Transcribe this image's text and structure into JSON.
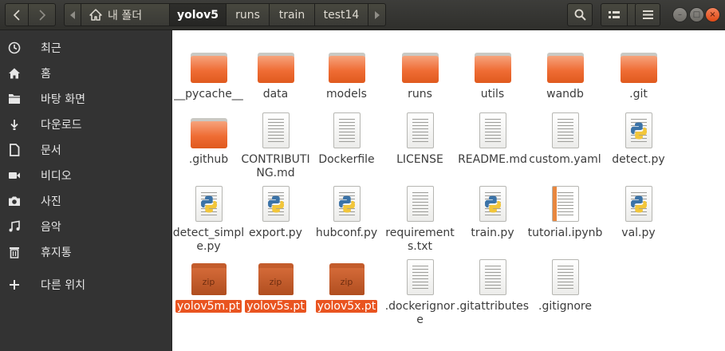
{
  "nav": {
    "back_icon": "chevron-left",
    "forward_icon": "chevron-right"
  },
  "breadcrumb": {
    "home_label": "내 폴더",
    "segments": [
      "yolov5",
      "runs",
      "train",
      "test14"
    ]
  },
  "toolbar": {
    "search_icon": "search",
    "view_icon": "grid-view",
    "menu_icon": "hamburger-menu"
  },
  "window_controls": {
    "minimize": "–",
    "maximize": "□",
    "close": "×"
  },
  "sidebar": {
    "items": [
      {
        "label": "최근",
        "icon": "clock"
      },
      {
        "label": "홈",
        "icon": "home"
      },
      {
        "label": "바탕 화면",
        "icon": "folder"
      },
      {
        "label": "다운로드",
        "icon": "download"
      },
      {
        "label": "문서",
        "icon": "document"
      },
      {
        "label": "비디오",
        "icon": "video"
      },
      {
        "label": "사진",
        "icon": "camera"
      },
      {
        "label": "음악",
        "icon": "music"
      },
      {
        "label": "휴지통",
        "icon": "trash"
      },
      {
        "label": "다른 위치",
        "icon": "plus"
      }
    ]
  },
  "files": [
    {
      "name": "__pycache__",
      "kind": "folder"
    },
    {
      "name": "data",
      "kind": "folder"
    },
    {
      "name": "models",
      "kind": "folder"
    },
    {
      "name": "runs",
      "kind": "folder"
    },
    {
      "name": "utils",
      "kind": "folder"
    },
    {
      "name": "wandb",
      "kind": "folder"
    },
    {
      "name": ".git",
      "kind": "folder"
    },
    {
      "name": ".github",
      "kind": "folder"
    },
    {
      "name": "CONTRIBUTING.md",
      "kind": "text"
    },
    {
      "name": "Dockerfile",
      "kind": "text"
    },
    {
      "name": "LICENSE",
      "kind": "text"
    },
    {
      "name": "README.md",
      "kind": "text"
    },
    {
      "name": "custom.yaml",
      "kind": "text"
    },
    {
      "name": "detect.py",
      "kind": "python"
    },
    {
      "name": "detect_simple.py",
      "kind": "python"
    },
    {
      "name": "export.py",
      "kind": "python"
    },
    {
      "name": "hubconf.py",
      "kind": "python"
    },
    {
      "name": "requirements.txt",
      "kind": "text"
    },
    {
      "name": "train.py",
      "kind": "python"
    },
    {
      "name": "tutorial.ipynb",
      "kind": "notebook"
    },
    {
      "name": "val.py",
      "kind": "python"
    },
    {
      "name": "yolov5m.pt",
      "kind": "zip",
      "selected": true
    },
    {
      "name": "yolov5s.pt",
      "kind": "zip",
      "selected": true
    },
    {
      "name": "yolov5x.pt",
      "kind": "zip",
      "selected": true
    },
    {
      "name": ".dockerignore",
      "kind": "text"
    },
    {
      "name": ".gitattributes",
      "kind": "text"
    },
    {
      "name": ".gitignore",
      "kind": "text"
    }
  ],
  "zip_badge": "zip",
  "colors": {
    "accent": "#e95420",
    "sidebar_bg": "#333333",
    "header_bg": "#3c3b37",
    "folder": "#ef6c34"
  }
}
